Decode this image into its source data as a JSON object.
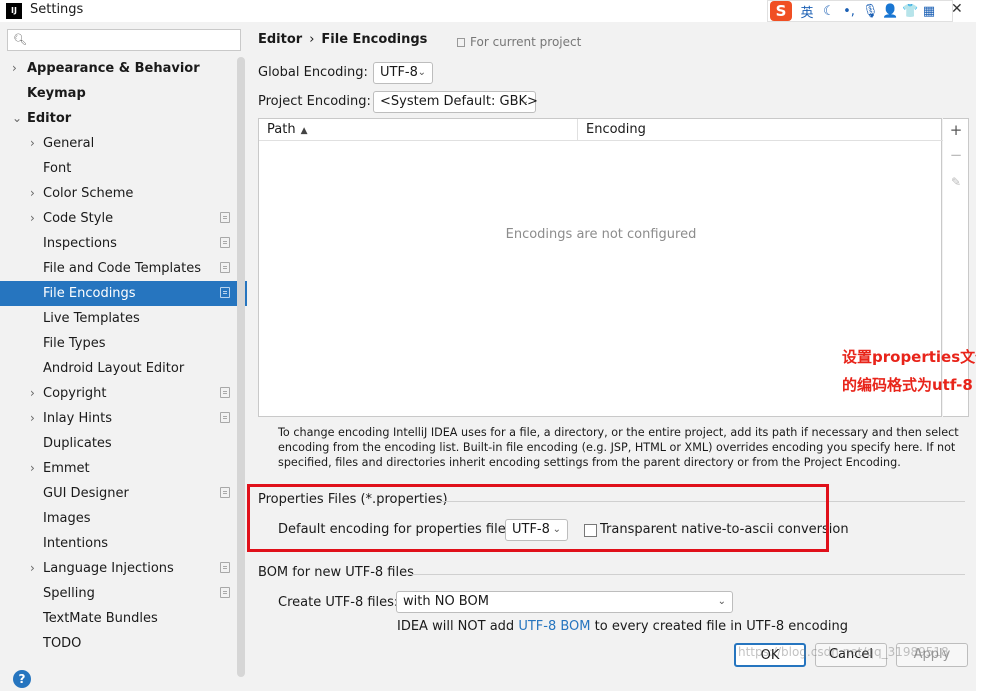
{
  "window": {
    "title": "Settings",
    "app_icon": "IJ"
  },
  "ime": {
    "logo": "S",
    "lang": "英",
    "items": [
      "moon-icon",
      "punctuation-icon",
      "microphone-icon",
      "user-icon",
      "shirt-icon",
      "grid-icon"
    ]
  },
  "sidebar": {
    "search_placeholder": "",
    "items": [
      {
        "label": "Appearance & Behavior",
        "level": 0,
        "arrow": "›",
        "proj": false
      },
      {
        "label": "Keymap",
        "level": 0,
        "arrow": "",
        "proj": false
      },
      {
        "label": "Editor",
        "level": 0,
        "arrow": "⌄",
        "proj": false
      },
      {
        "label": "General",
        "level": 1,
        "arrow": "›",
        "proj": false
      },
      {
        "label": "Font",
        "level": 1,
        "arrow": "",
        "proj": false
      },
      {
        "label": "Color Scheme",
        "level": 1,
        "arrow": "›",
        "proj": false
      },
      {
        "label": "Code Style",
        "level": 1,
        "arrow": "›",
        "proj": true
      },
      {
        "label": "Inspections",
        "level": 1,
        "arrow": "",
        "proj": true
      },
      {
        "label": "File and Code Templates",
        "level": 1,
        "arrow": "",
        "proj": true
      },
      {
        "label": "File Encodings",
        "level": 1,
        "arrow": "",
        "proj": true,
        "selected": true
      },
      {
        "label": "Live Templates",
        "level": 1,
        "arrow": "",
        "proj": false
      },
      {
        "label": "File Types",
        "level": 1,
        "arrow": "",
        "proj": false
      },
      {
        "label": "Android Layout Editor",
        "level": 1,
        "arrow": "",
        "proj": false
      },
      {
        "label": "Copyright",
        "level": 1,
        "arrow": "›",
        "proj": true
      },
      {
        "label": "Inlay Hints",
        "level": 1,
        "arrow": "›",
        "proj": true
      },
      {
        "label": "Duplicates",
        "level": 1,
        "arrow": "",
        "proj": false
      },
      {
        "label": "Emmet",
        "level": 1,
        "arrow": "›",
        "proj": false
      },
      {
        "label": "GUI Designer",
        "level": 1,
        "arrow": "",
        "proj": true
      },
      {
        "label": "Images",
        "level": 1,
        "arrow": "",
        "proj": false
      },
      {
        "label": "Intentions",
        "level": 1,
        "arrow": "",
        "proj": false
      },
      {
        "label": "Language Injections",
        "level": 1,
        "arrow": "›",
        "proj": true
      },
      {
        "label": "Spelling",
        "level": 1,
        "arrow": "",
        "proj": true
      },
      {
        "label": "TextMate Bundles",
        "level": 1,
        "arrow": "",
        "proj": false
      },
      {
        "label": "TODO",
        "level": 1,
        "arrow": "",
        "proj": false
      }
    ],
    "help": "?"
  },
  "main": {
    "breadcrumb": {
      "root": "Editor",
      "sep": "›",
      "current": "File Encodings"
    },
    "scope": "For current project",
    "global_encoding": {
      "label": "Global Encoding:",
      "value": "UTF-8"
    },
    "project_encoding": {
      "label": "Project Encoding:",
      "value": "<System Default: GBK>"
    },
    "table": {
      "col_path": "Path",
      "sort": "▲",
      "col_encoding": "Encoding",
      "empty": "Encodings are not configured",
      "tools": {
        "add": "+",
        "remove": "−",
        "edit": "✎"
      }
    },
    "note": "To change encoding IntelliJ IDEA uses for a file, a directory, or the entire project, add its path if necessary and then select encoding from the encoding list. Built-in file encoding (e.g. JSP, HTML or XML) overrides encoding you specify here. If not specified, files and directories inherit encoding settings from the parent directory or from the Project Encoding.",
    "annotation": {
      "line1": "设置properties文件",
      "line2": "的编码格式为utf-8"
    },
    "properties": {
      "title": "Properties Files (*.properties)",
      "default_label": "Default encoding for properties files:",
      "default_value": "UTF-8",
      "checkbox_label": "Transparent native-to-ascii conversion"
    },
    "bom": {
      "title": "BOM for new UTF-8 files",
      "create_label": "Create UTF-8 files:",
      "create_value": "with NO BOM",
      "info_pre": "IDEA will NOT add ",
      "info_link": "UTF-8 BOM",
      "info_post": " to every created file in UTF-8 encoding"
    }
  },
  "buttons": {
    "ok": "OK",
    "cancel": "Cancel",
    "apply": "Apply"
  },
  "watermark": "https://blog.csdn.net/qq_31989518",
  "colors": {
    "selection": "#2675bf",
    "annotation": "#e8241a",
    "red_box": "#e0101a",
    "link": "#2675bf"
  }
}
